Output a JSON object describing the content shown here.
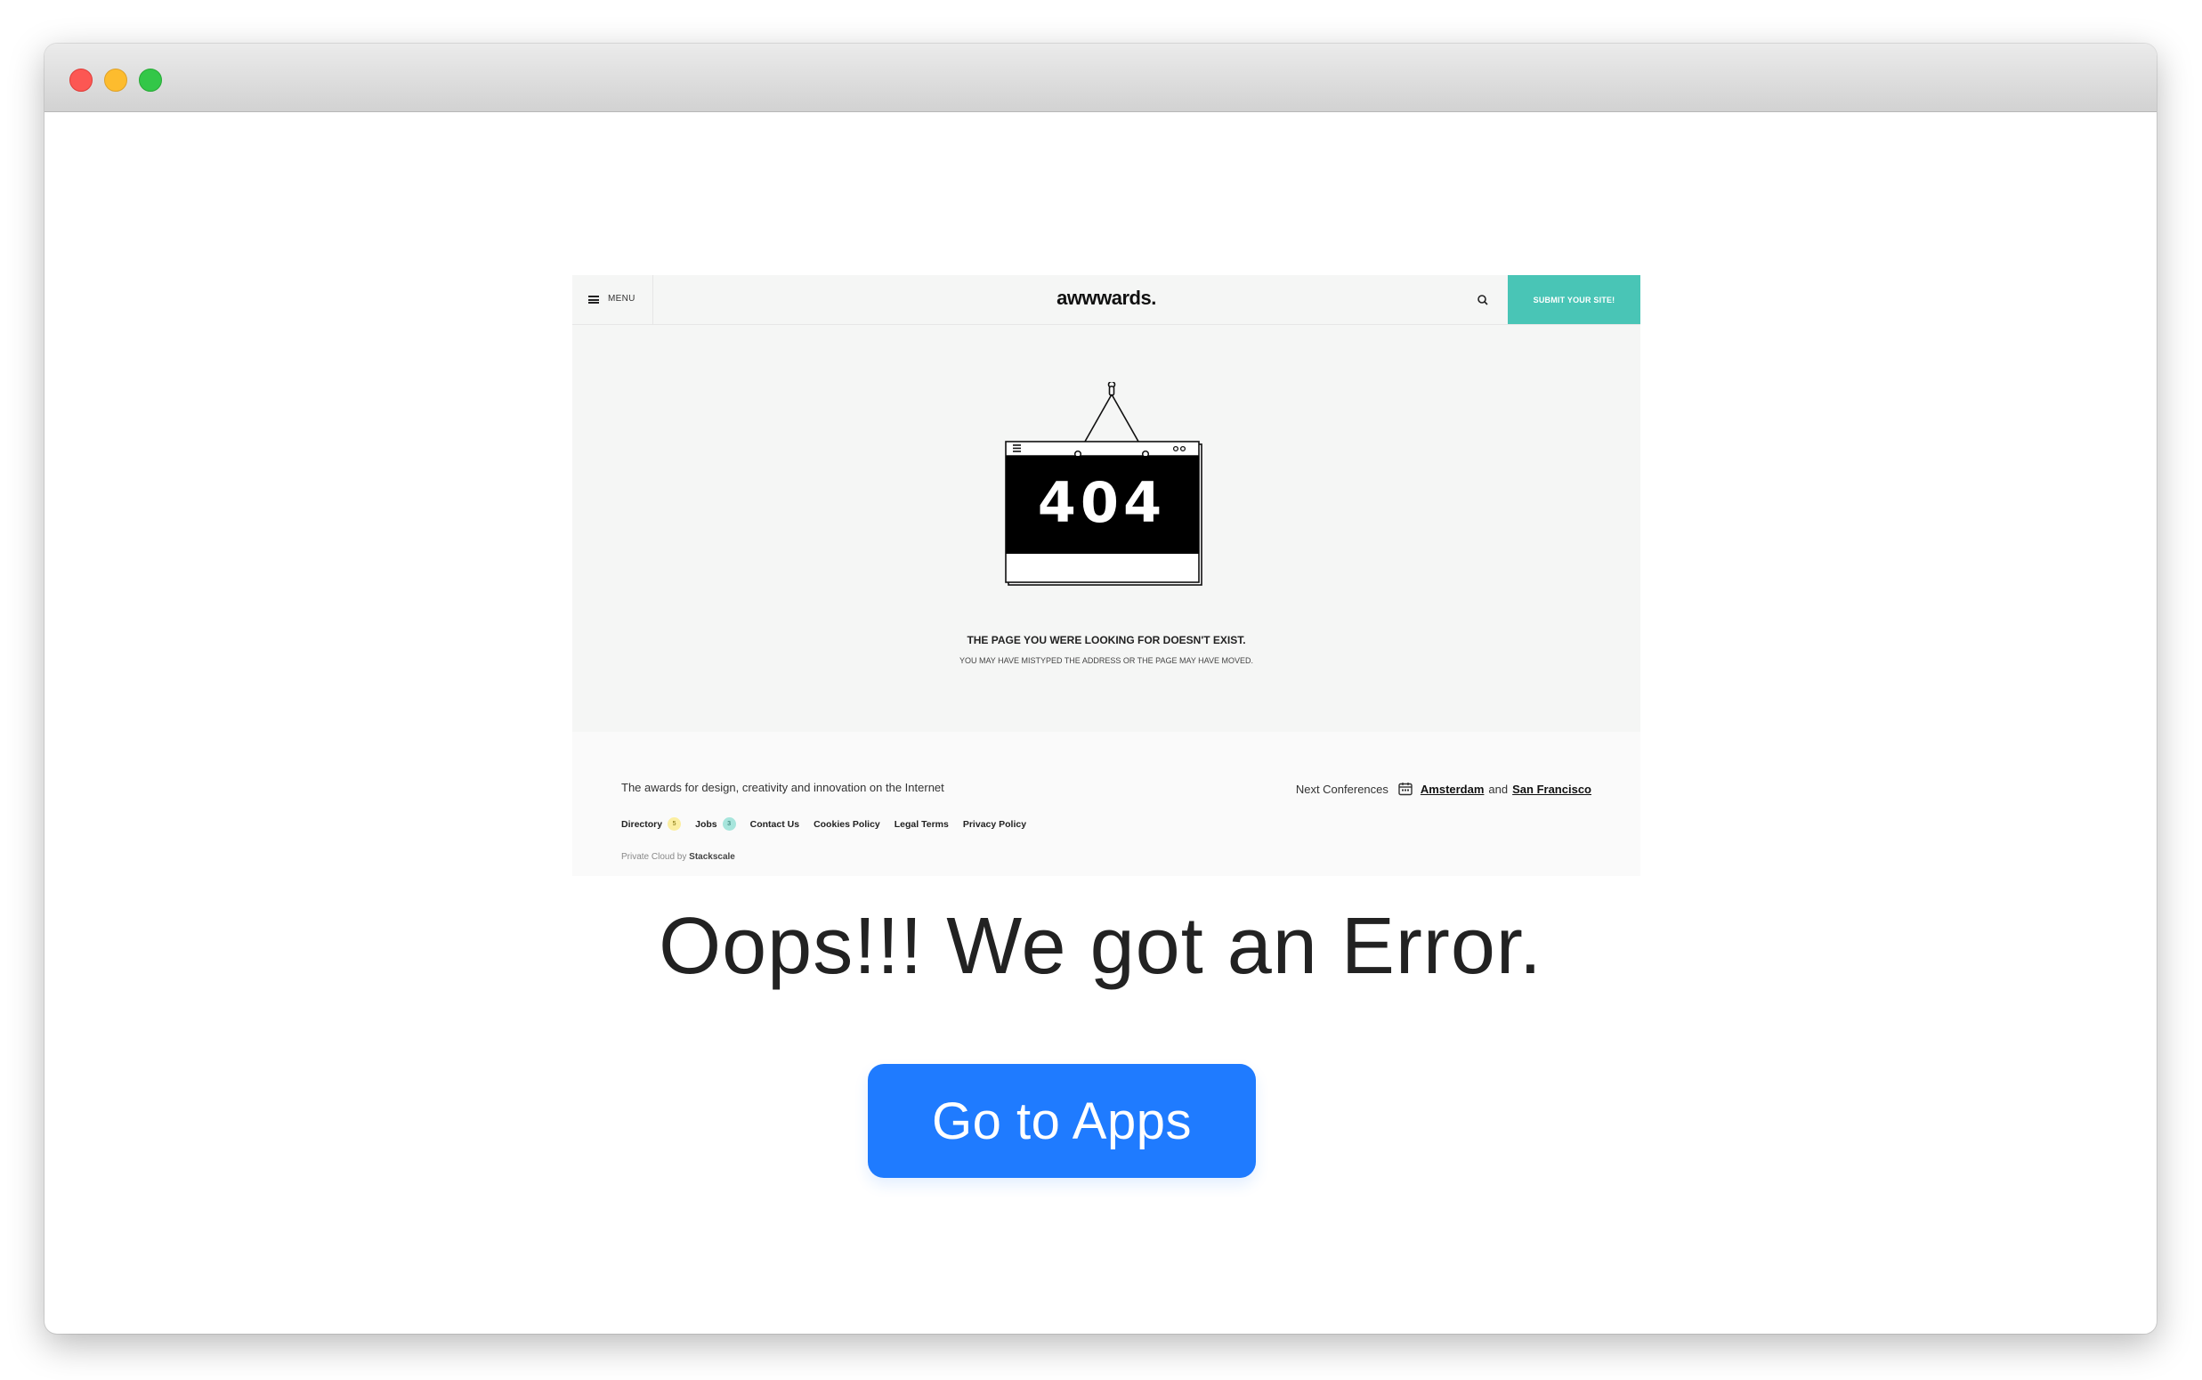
{
  "window": {
    "controls": [
      "close",
      "minimize",
      "zoom"
    ]
  },
  "embedded_page": {
    "menu_label": "MENU",
    "brand": "awwwards.",
    "submit_label": "SUBMIT YOUR SITE!",
    "error_code": "404",
    "message_title": "THE PAGE YOU WERE LOOKING FOR DOESN'T EXIST.",
    "message_sub": "YOU MAY HAVE MISTYPED THE ADDRESS OR THE PAGE MAY HAVE MOVED.",
    "footer": {
      "tagline": "The awards for design, creativity and innovation on the Internet",
      "conferences_label": "Next Conferences",
      "conference_1": "Amsterdam",
      "conference_and": "and",
      "conference_2": "San Francisco",
      "links": {
        "directory": "Directory",
        "directory_count": "5",
        "jobs": "Jobs",
        "jobs_count": "3",
        "contact": "Contact Us",
        "cookies": "Cookies Policy",
        "legal": "Legal Terms",
        "privacy": "Privacy Policy"
      },
      "credit_prefix": "Private Cloud by",
      "credit_name": "Stackscale"
    },
    "accent_color": "#49c5b6"
  },
  "headline": "Oops!!! We got an Error.",
  "cta_label": "Go to Apps",
  "cta_color": "#1f7bff"
}
